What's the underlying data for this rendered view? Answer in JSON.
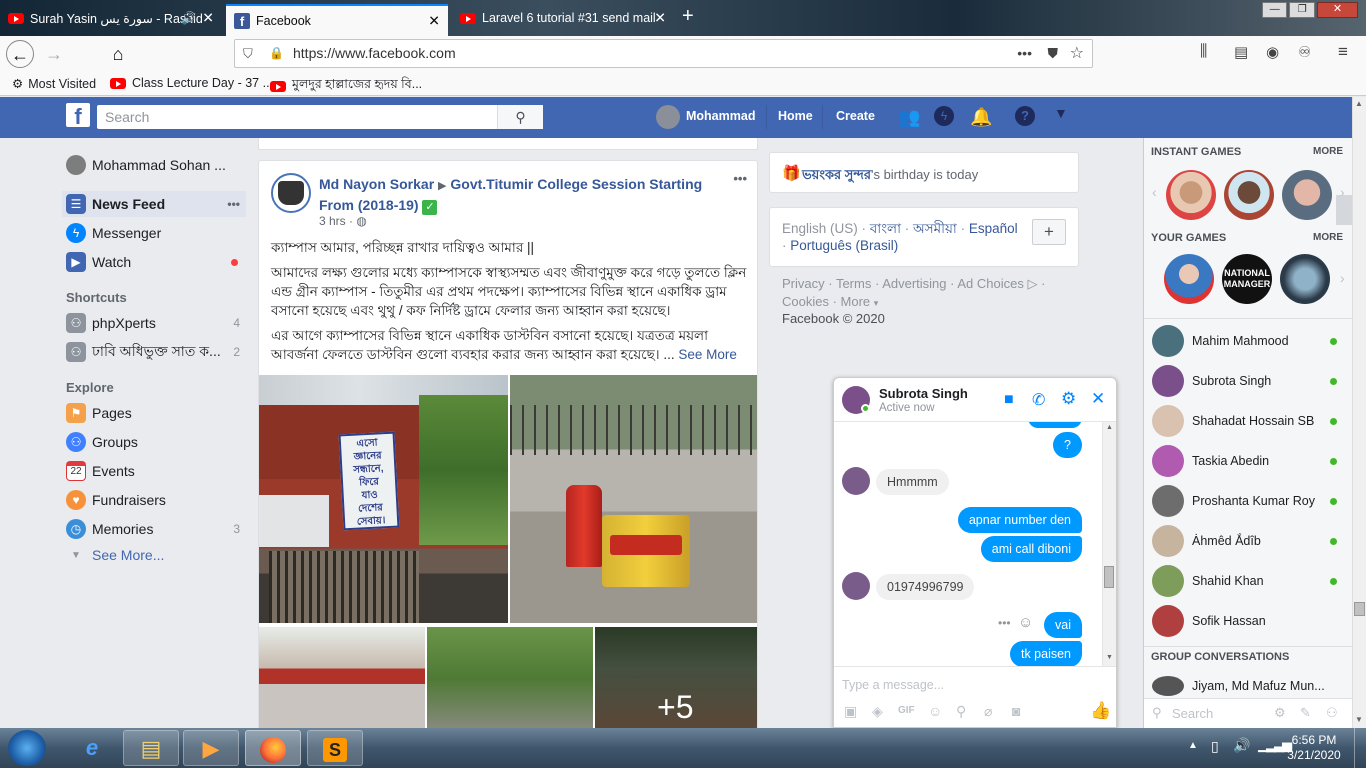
{
  "browser": {
    "tabs": [
      {
        "label": "Surah Yasin سورة يس - Rashid",
        "icon": "youtube-icon"
      },
      {
        "label": "Facebook",
        "icon": "facebook-icon"
      },
      {
        "label": "Laravel 6 tutorial #31 send mail",
        "icon": "youtube-icon"
      }
    ],
    "url": "https://www.facebook.com",
    "bookmarks": [
      {
        "label": "Most Visited"
      },
      {
        "label": "Class Lecture Day - 37 ..."
      },
      {
        "label": "মুলদুর হাল্লাজের হৃদয় বি..."
      }
    ]
  },
  "header": {
    "search_placeholder": "Search",
    "profile_name": "Mohammad",
    "home": "Home",
    "create": "Create"
  },
  "leftnav": {
    "profile": "Mohammad Sohan ...",
    "items": [
      {
        "label": "News Feed",
        "dots": "•••"
      },
      {
        "label": "Messenger"
      },
      {
        "label": "Watch"
      }
    ],
    "shortcuts_title": "Shortcuts",
    "shortcuts": [
      {
        "label": "phpXperts",
        "count": "4"
      },
      {
        "label": "ঢাবি অধিভুক্ত সাত ক...",
        "count": "2"
      }
    ],
    "explore_title": "Explore",
    "explore": [
      {
        "label": "Pages"
      },
      {
        "label": "Groups"
      },
      {
        "label": "Events",
        "icon_text": "22"
      },
      {
        "label": "Fundraisers"
      },
      {
        "label": "Memories",
        "count": "3"
      }
    ],
    "see_more": "See More..."
  },
  "post": {
    "author": "Md Nayon Sorkar",
    "group": "Govt.Titumir College Session Starting From (2018-19)",
    "time": "3 hrs",
    "menu": "•••",
    "p1": "ক্যাম্পাস আমার, পরিচ্ছন্ন রাখার দায়িত্বও আমার ||",
    "p2": "আমাদের লক্ষ্য গুলোর মধ্যে ক্যাম্পাসকে স্বাস্থ্যসম্মত এবং জীবাণুমুক্ত করে গড়ে তুলতে ক্লিন এন্ড গ্রীন ক্যাম্পাস - তিতুমীর এর প্রথম পদক্ষেপ। ক্যাম্পাসের বিভিন্ন স্থানে একাধিক ড্রাম বসানো হয়েছে এবং থুথু / কফ নির্দিষ্ট ড্রামে ফেলার জন্য আহ্বান করা হয়েছে।",
    "p3": "এর আগে ক্যাম্পাসের বিভিন্ন স্থানে একাধিক ডাস্টবিন বসানো হয়েছে। যত্রতত্র ময়লা আবর্জনা ফেলতে ডাস্টবিন গুলো ব্যবহার করার জন্য আহ্বান করা হয়েছে। ...",
    "see_more": "See More",
    "sign_lines": [
      "এসো",
      "জ্ঞানের",
      "সন্ধানে,",
      "ফিরে",
      "যাও",
      "দেশের",
      "সেবায়।"
    ],
    "more_photos": "+5"
  },
  "right": {
    "birthday_name": "ভয়ংকর সুন্দর",
    "birthday_text": "'s birthday is today",
    "languages": [
      "English (US)",
      "বাংলা",
      "অসমীয়া",
      "Español",
      "Português (Brasil)"
    ],
    "lang_add": "+",
    "footer_links": [
      "Privacy",
      "Terms",
      "Advertising",
      "Ad Choices",
      "Cookies",
      "More"
    ],
    "copyright": "Facebook © 2020"
  },
  "sidebar": {
    "instant_games": "INSTANT GAMES",
    "your_games": "YOUR GAMES",
    "more": "MORE",
    "game_label": "NATIONAL MANAGER",
    "contacts": [
      "Mahim Mahmood",
      "Subrota Singh",
      "Shahadat Hossain SB",
      "Taskia Abedin",
      "Proshanta Kumar Roy",
      "Ȧhmêd Ắdîb",
      "Shahid Khan",
      "Sofik Hassan"
    ],
    "group_conversations": "GROUP CONVERSATIONS",
    "group_item": "Jiyam, Md Mafuz Mun...",
    "search_placeholder": "Search"
  },
  "chat": {
    "name": "Subrota Singh",
    "status": "Active now",
    "messages": [
      {
        "from": "me",
        "text": "?"
      },
      {
        "from": "them",
        "text": "Hmmmm"
      },
      {
        "from": "me",
        "text": "apnar number den"
      },
      {
        "from": "me",
        "text": "ami call diboni"
      },
      {
        "from": "them",
        "text": "01974996799"
      },
      {
        "from": "me",
        "text": "vai"
      },
      {
        "from": "me",
        "text": "tk paisen"
      }
    ],
    "input_placeholder": "Type a message..."
  },
  "taskbar": {
    "time": "6:56 PM",
    "date": "3/21/2020"
  },
  "colors": {
    "fb_blue": "#4267b2",
    "messenger_blue": "#0099ff",
    "online_green": "#42b72a"
  }
}
